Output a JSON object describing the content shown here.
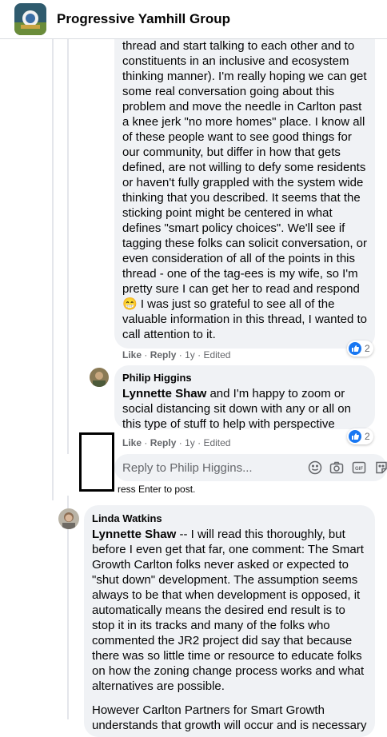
{
  "group": {
    "name": "Progressive Yamhill Group"
  },
  "comments": [
    {
      "text": "thread and start talking to each other and to constituents in an inclusive and ecosystem thinking manner). I'm really hoping we can get some real conversation going about this problem and move the needle in Carlton past a knee jerk \"no more homes\" place. I know all of these people want to see good things for our community, but differ in how that gets defined, are not willing to defy some residents or haven't fully grappled with the system wide thinking that you described. It seems that the sticking point might be centered in what defines \"smart policy choices\". We'll see if tagging these folks can solicit conversation, or even consideration of all of the points in this thread - one of the tag-ees is my wife, so I'm pretty sure I can get her to read and respond 😁 I was just so grateful to see all of the valuable information in this thread, I wanted to call attention to it.",
      "like": "Like",
      "reply": "Reply",
      "time": "1y",
      "edited": "Edited",
      "reactions": "2"
    },
    {
      "author": "Philip Higgins",
      "mention": "Lynnette Shaw",
      "text": " and I'm happy to zoom or social distancing sit down with any or all on this type of stuff to help with perspective",
      "like": "Like",
      "reply": "Reply",
      "time": "1y",
      "edited": "Edited",
      "reactions": "2"
    },
    {
      "author": "Linda Watkins",
      "mention": "Lynnette Shaw",
      "text": " -- I will read this thoroughly, but before I even get that far, one comment: The Smart Growth Carlton folks never asked or expected to \"shut down\" development. The assumption seems always to be that when development is opposed, it automatically means the desired end result is to stop it in its tracks and many of the folks who commented the JR2 project did say that because there was so little time or resource to educate folks on how the zoning change process works and what alternatives are possible.",
      "text2": "However Carlton Partners for Smart Growth understands that growth will occur and is necessary"
    }
  ],
  "reply_box": {
    "placeholder": "Reply to Philip Higgins...",
    "hint": "ress Enter to post."
  },
  "icons": [
    "group-logo-icon",
    "emoji-icon",
    "camera-icon",
    "gif-icon",
    "sticker-icon",
    "like-reaction-icon"
  ],
  "colors": {
    "like_blue": "#1877f2",
    "bubble": "#f0f2f5",
    "meta_gray": "#65676b"
  }
}
